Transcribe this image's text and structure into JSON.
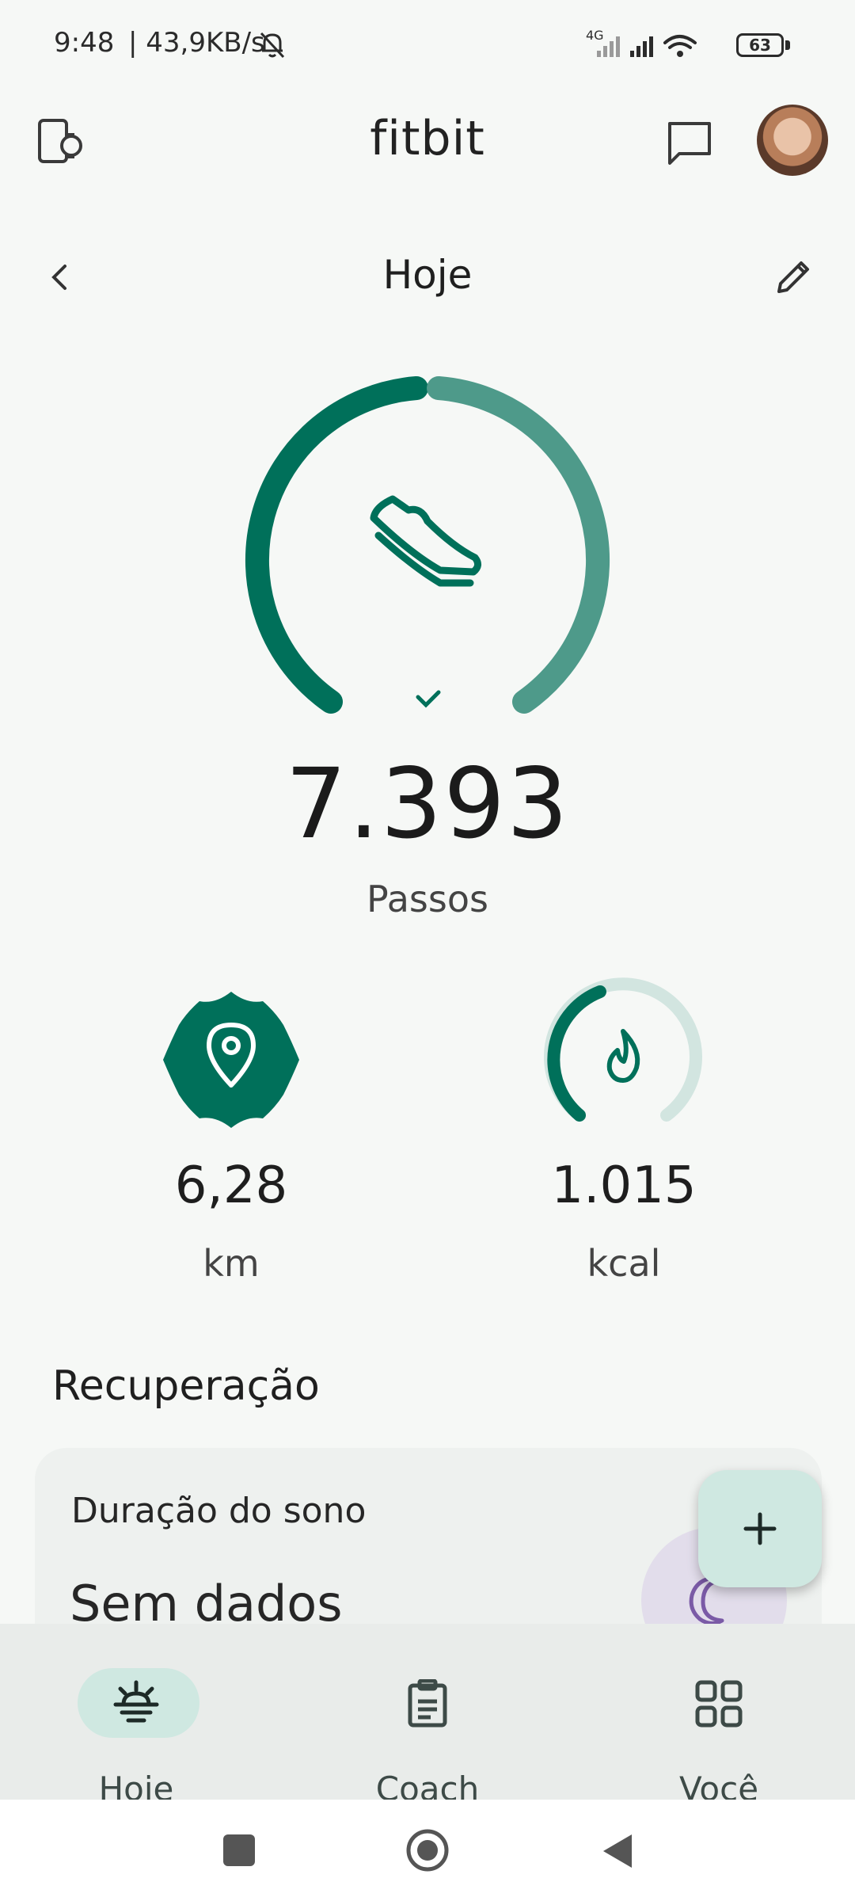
{
  "status_bar": {
    "time": "9:48",
    "network_speed": "| 43,9KB/s",
    "network_type": "4G",
    "battery": "63",
    "icons": [
      "bell-off-icon",
      "signal-icon",
      "wifi-icon",
      "battery-icon"
    ]
  },
  "header": {
    "title": "fitbit",
    "left_icon": "devices-icon",
    "right_icon": "messages-icon"
  },
  "date_nav": {
    "title": "Hoje",
    "back_icon": "chevron-left-icon",
    "edit_icon": "pencil-icon"
  },
  "steps": {
    "value": "7.393",
    "label": "Passos",
    "goal_met": true,
    "progress": 1.0,
    "icon": "shoe-icon"
  },
  "stats": [
    {
      "value": "6,28",
      "unit": "km",
      "icon": "location-pin-icon"
    },
    {
      "value": "1.015",
      "unit": "kcal",
      "icon": "flame-icon",
      "progress": 0.42
    }
  ],
  "recovery": {
    "section_title": "Recuperação",
    "card_title": "Duração do sono",
    "card_value": "Sem dados",
    "icon": "moon-icon"
  },
  "fab": {
    "icon": "plus-icon"
  },
  "bottom_nav": {
    "items": [
      {
        "label": "Hoje",
        "icon": "sunrise-icon",
        "active": true
      },
      {
        "label": "Coach",
        "icon": "clipboard-icon",
        "active": false
      },
      {
        "label": "Você",
        "icon": "grid-icon",
        "active": false
      }
    ]
  },
  "colors": {
    "primary": "#00705a",
    "primary_light": "#4e9a8a",
    "track_light": "#d2e5e0",
    "background": "#f6f8f6",
    "accent_container": "#cfe8e1",
    "moon": "#7a5aa6"
  }
}
